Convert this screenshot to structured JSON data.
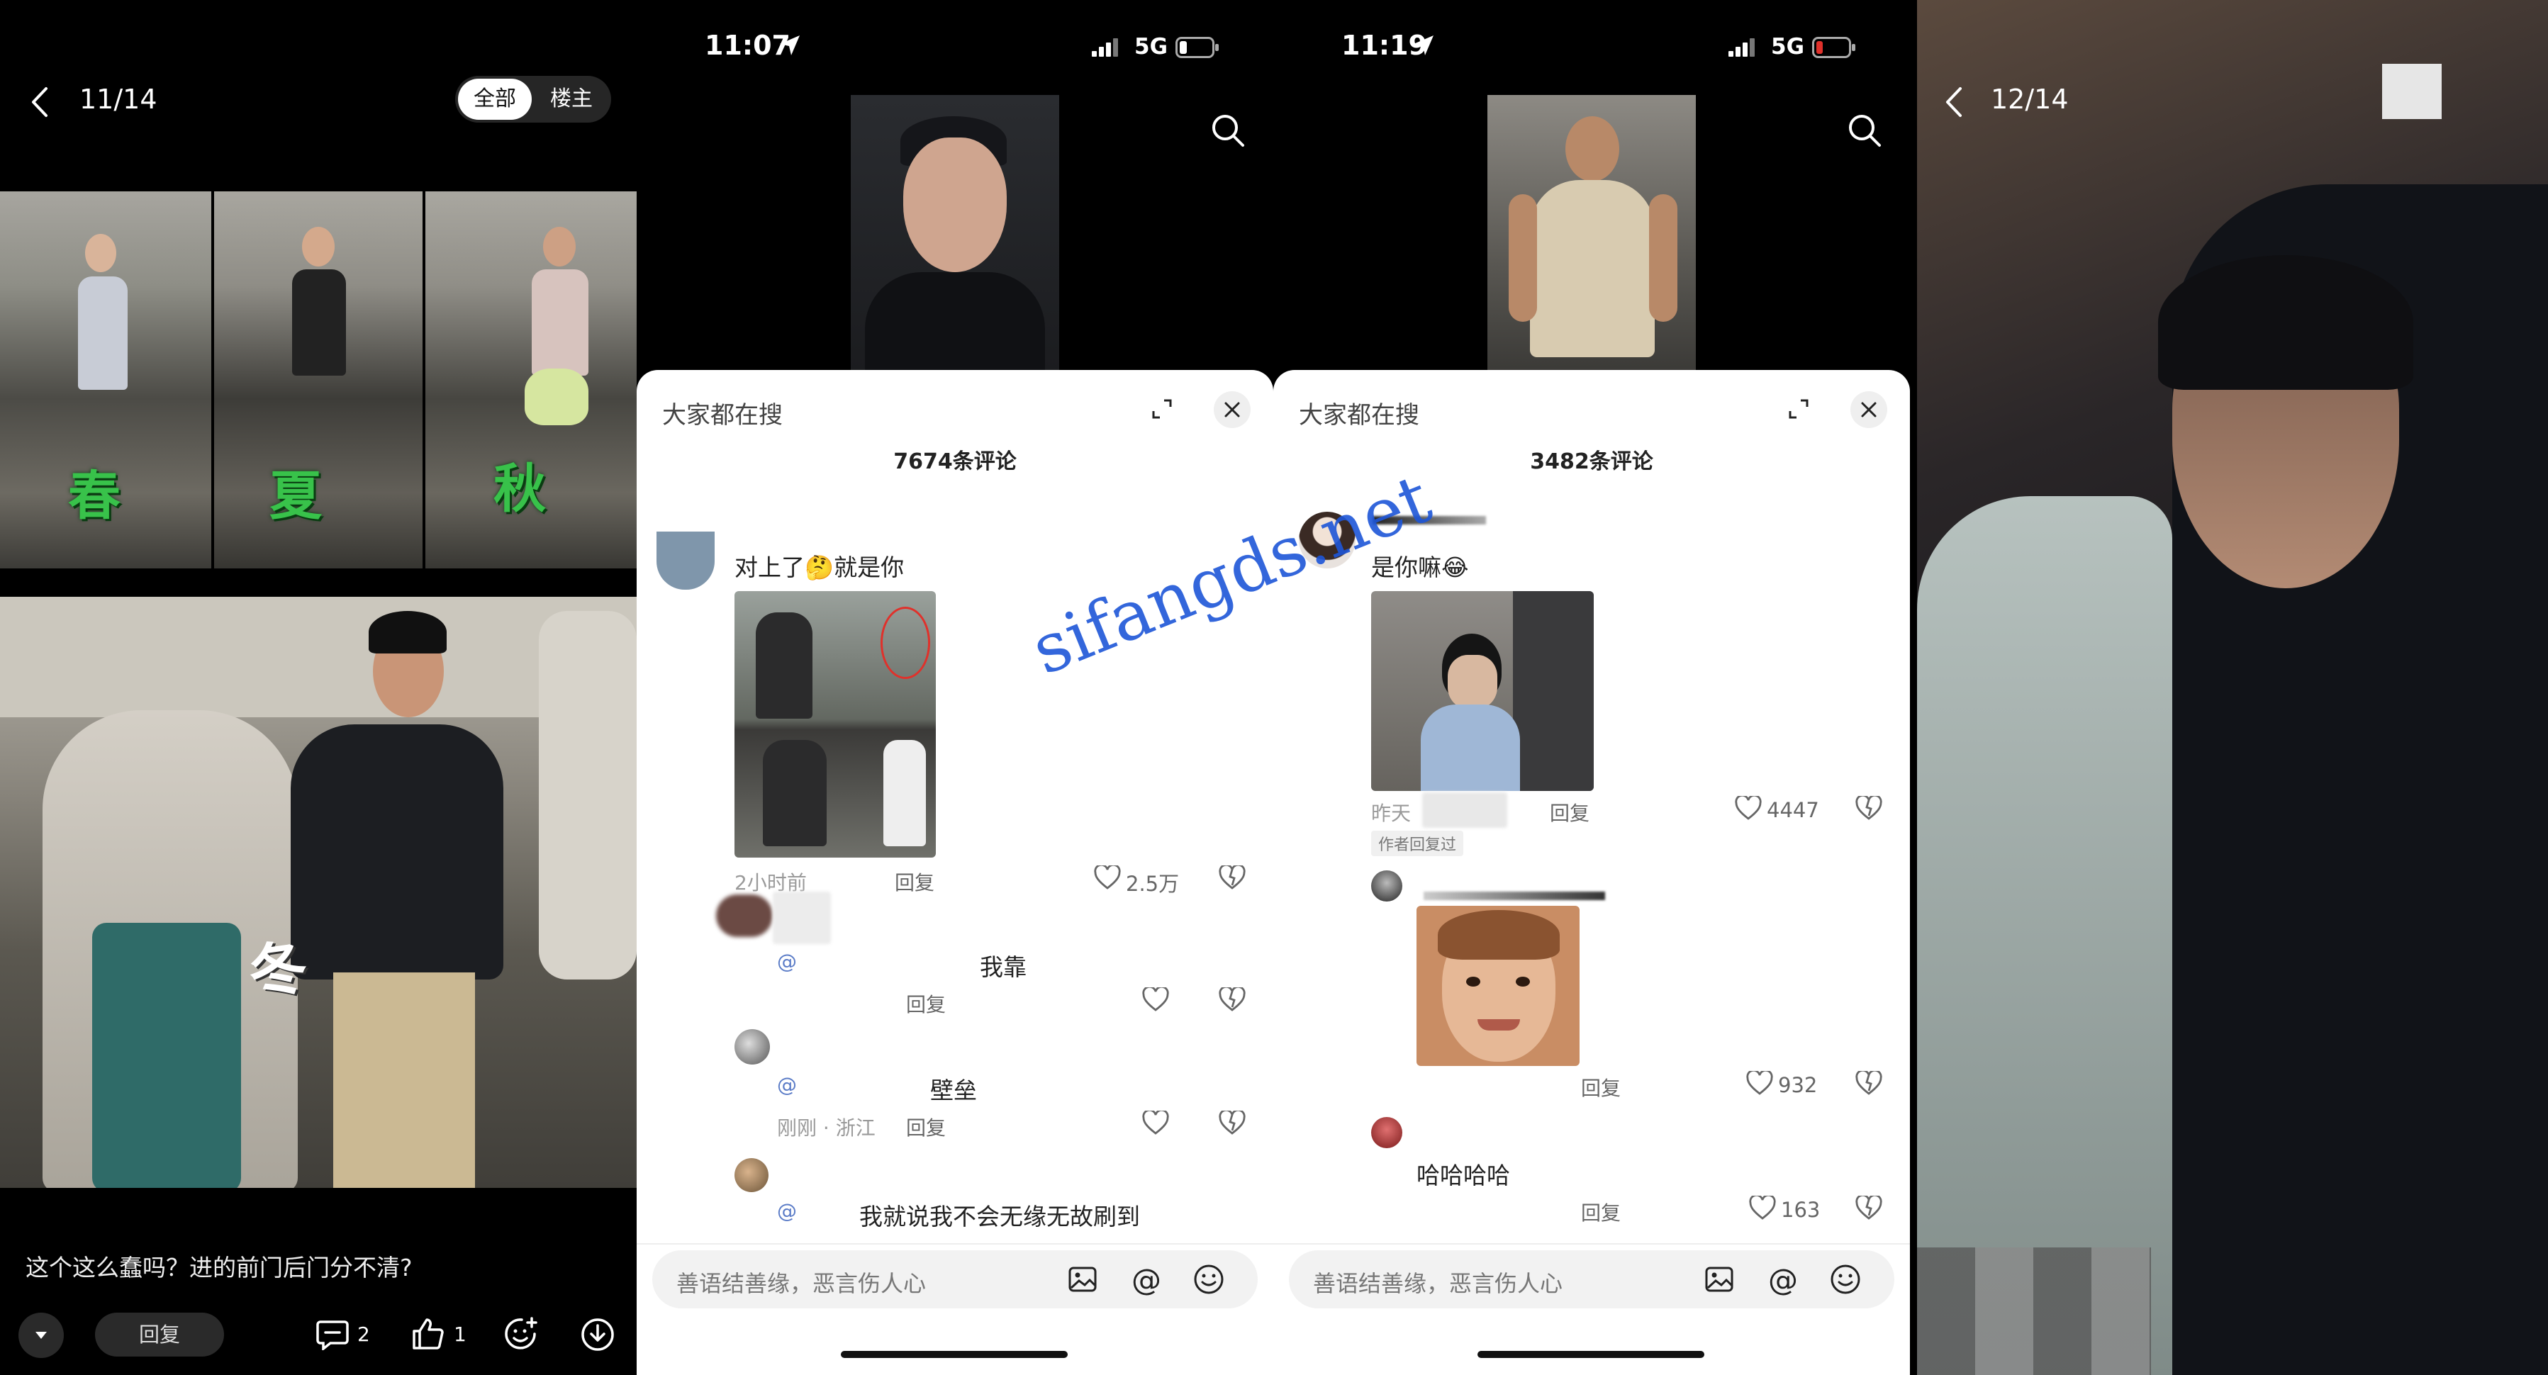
{
  "panel1": {
    "page_counter": "11/14",
    "toggle": {
      "all": "全部",
      "owner": "楼主"
    },
    "season_labels": [
      "春",
      "夏",
      "秋"
    ],
    "winter_label": "冬",
    "caption": "这个这么蠢吗？进的前门后门分不清?",
    "reply_button": "回复",
    "comment_count": "2",
    "like_count": "1"
  },
  "panel2": {
    "status": {
      "time": "11:07",
      "network": "5G"
    },
    "sheet_title": "大家都在搜",
    "comment_count": "7674条评论",
    "comments": [
      {
        "text": "对上了🤔就是你",
        "time": "2小时前",
        "reply": "回复",
        "likes": "2.5万"
      },
      {
        "mention": "@",
        "text": "我靠",
        "reply": "回复"
      },
      {
        "mention": "@",
        "text": "壁垒",
        "time": "刚刚 · 浙江",
        "reply": "回复"
      },
      {
        "mention": "@",
        "text": "我就说我不会无缘无故刷到"
      }
    ],
    "input_placeholder": "善语结善缘，恶言伤人心"
  },
  "panel3": {
    "status": {
      "time": "11:19",
      "network": "5G"
    },
    "sheet_title": "大家都在搜",
    "comment_count": "3482条评论",
    "comments": [
      {
        "text": "是你嘛😂",
        "time": "昨天",
        "author_badge": "作者回复过",
        "reply": "回复",
        "likes": "4447"
      },
      {
        "reply": "回复",
        "likes": "932"
      },
      {
        "text": "哈哈哈哈",
        "reply": "回复",
        "likes": "163"
      }
    ],
    "input_placeholder": "善语结善缘，恶言伤人心"
  },
  "panel4": {
    "page_counter": "12/14"
  },
  "watermark": "sifangds.net",
  "colors": {
    "accent_red": "#e0312b",
    "sheet_bg": "#ffffff",
    "dark_bg": "#000000",
    "subtitle_green": "#38c24a",
    "watermark_blue": "#1e56d8"
  }
}
